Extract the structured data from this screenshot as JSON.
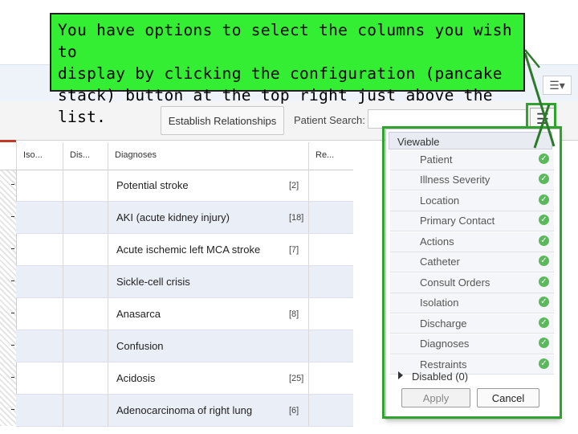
{
  "callout": {
    "text": "You have options to select the columns you wish to\ndisplay by clicking the configuration (pancake\nstack) button at the top right just above the list."
  },
  "toolbar": {
    "establish_label": "Establish Relationships",
    "search_label": "Patient Search:",
    "search_value": "",
    "menu_icon": "hamburger-menu-icon",
    "top_button_icon": "hamburger-dropdown-icon"
  },
  "grid": {
    "columns": [
      "Iso...",
      "Dis...",
      "Diagnoses",
      "Re..."
    ],
    "rows": [
      {
        "diagnosis": "Potential stroke",
        "count": "[2]"
      },
      {
        "diagnosis": "AKI (acute kidney injury)",
        "count": "[18]"
      },
      {
        "diagnosis": "Acute ischemic left MCA stroke",
        "count": "[7]"
      },
      {
        "diagnosis": "Sickle-cell crisis",
        "count": ""
      },
      {
        "diagnosis": "Anasarca",
        "count": "[8]"
      },
      {
        "diagnosis": "Confusion",
        "count": ""
      },
      {
        "diagnosis": "Acidosis",
        "count": "[25]"
      },
      {
        "diagnosis": "Adenocarcinoma of right lung",
        "count": "[6]"
      }
    ]
  },
  "panel": {
    "viewable_label": "Viewable",
    "items": [
      "Patient",
      "Illness Severity",
      "Location",
      "Primary Contact",
      "Actions",
      "Catheter",
      "Consult Orders",
      "Isolation",
      "Discharge",
      "Diagnoses",
      "Restraints"
    ],
    "disabled_label": "Disabled (0)",
    "apply_label": "Apply",
    "cancel_label": "Cancel"
  },
  "colors": {
    "highlight": "#2fa22f",
    "callout_bg": "#33ee33",
    "check": "#5cb85c"
  }
}
